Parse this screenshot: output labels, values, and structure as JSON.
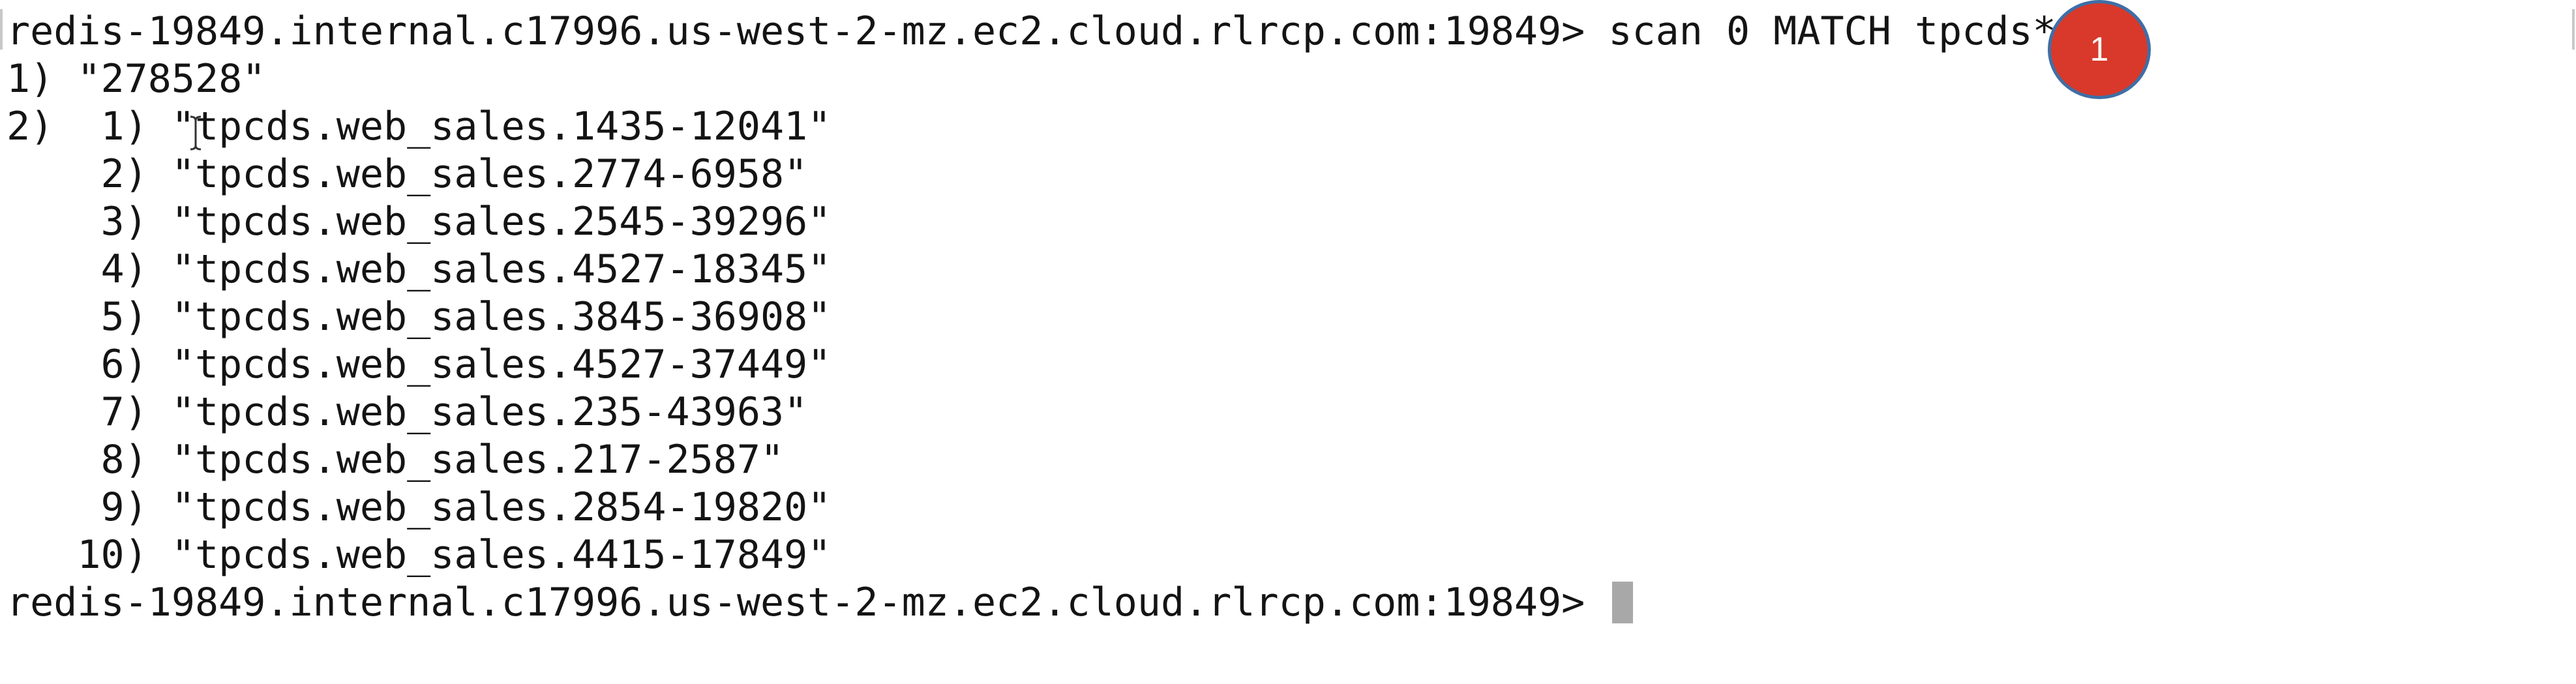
{
  "terminal": {
    "command_prompt": "redis-19849.internal.c17996.us-west-2-mz.ec2.cloud.rlrcp.com:19849>",
    "command": "scan 0 MATCH tpcds*",
    "cursor_line": {
      "index": "1)",
      "value": "\"278528\""
    },
    "keys_group_index": "2)",
    "keys": [
      {
        "index": "1)",
        "value": "\"tpcds.web_sales.1435-12041\""
      },
      {
        "index": "2)",
        "value": "\"tpcds.web_sales.2774-6958\""
      },
      {
        "index": "3)",
        "value": "\"tpcds.web_sales.2545-39296\""
      },
      {
        "index": "4)",
        "value": "\"tpcds.web_sales.4527-18345\""
      },
      {
        "index": "5)",
        "value": "\"tpcds.web_sales.3845-36908\""
      },
      {
        "index": "6)",
        "value": "\"tpcds.web_sales.4527-37449\""
      },
      {
        "index": "7)",
        "value": "\"tpcds.web_sales.235-43963\""
      },
      {
        "index": "8)",
        "value": "\"tpcds.web_sales.217-2587\""
      },
      {
        "index": "9)",
        "value": "\"tpcds.web_sales.2854-19820\""
      },
      {
        "index": "10)",
        "value": "\"tpcds.web_sales.4415-17849\""
      }
    ],
    "final_prompt": "redis-19849.internal.c17996.us-west-2-mz.ec2.cloud.rlrcp.com:19849>"
  },
  "annotation": {
    "badge_number": "1",
    "badge_color": "#d8392b",
    "badge_border_color": "#3f6ea6"
  },
  "colors": {
    "background": "#ffffff",
    "text": "#141414",
    "cursor": "#a8a8a8"
  }
}
